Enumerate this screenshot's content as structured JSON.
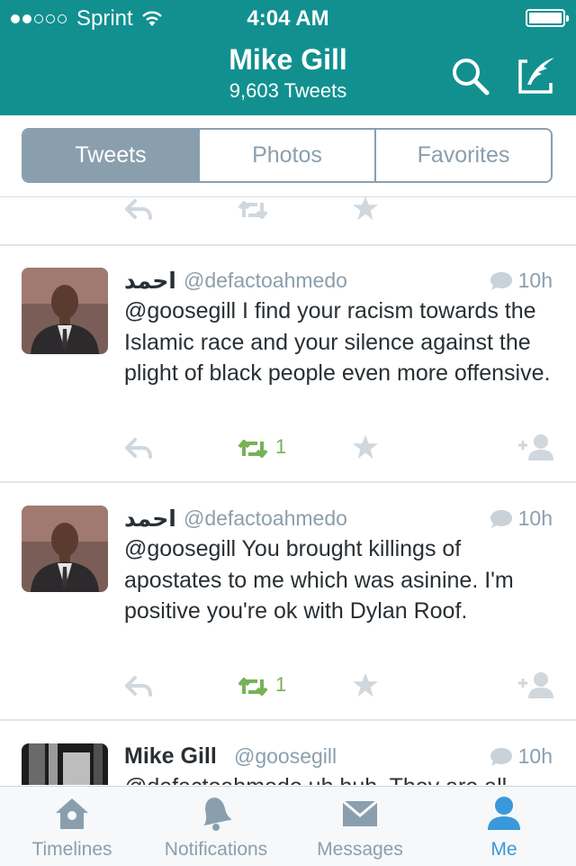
{
  "status_bar": {
    "carrier": "Sprint",
    "time": "4:04 AM"
  },
  "header": {
    "title": "Mike Gill",
    "subtitle": "9,603 Tweets"
  },
  "segments": [
    {
      "label": "Tweets",
      "active": true
    },
    {
      "label": "Photos",
      "active": false
    },
    {
      "label": "Favorites",
      "active": false
    }
  ],
  "tweets": [
    {
      "name": "احمد",
      "handle": "@defactoahmedo",
      "time": "10h",
      "text": "@goosegill I find your racism towards the Islamic race and your silence against the plight of black people even more offensive.",
      "retweets": "1"
    },
    {
      "name": "احمد",
      "handle": "@defactoahmedo",
      "time": "10h",
      "text": "@goosegill You brought killings of apostates to me which was asinine. I'm positive you're ok with Dylan Roof.",
      "retweets": "1"
    },
    {
      "name": "Mike Gill",
      "handle": "@goosegill",
      "time": "10h",
      "text": "@defactoahmedo uh huh. They are all"
    }
  ],
  "tab_bar": [
    {
      "label": "Timelines",
      "icon": "home-icon"
    },
    {
      "label": "Notifications",
      "icon": "bell-icon"
    },
    {
      "label": "Messages",
      "icon": "envelope-icon"
    },
    {
      "label": "Me",
      "icon": "person-icon",
      "active": true
    }
  ],
  "colors": {
    "header": "#129090",
    "segment": "#8a9fae",
    "retweet": "#77b255",
    "active_tab": "#3a98dc"
  }
}
